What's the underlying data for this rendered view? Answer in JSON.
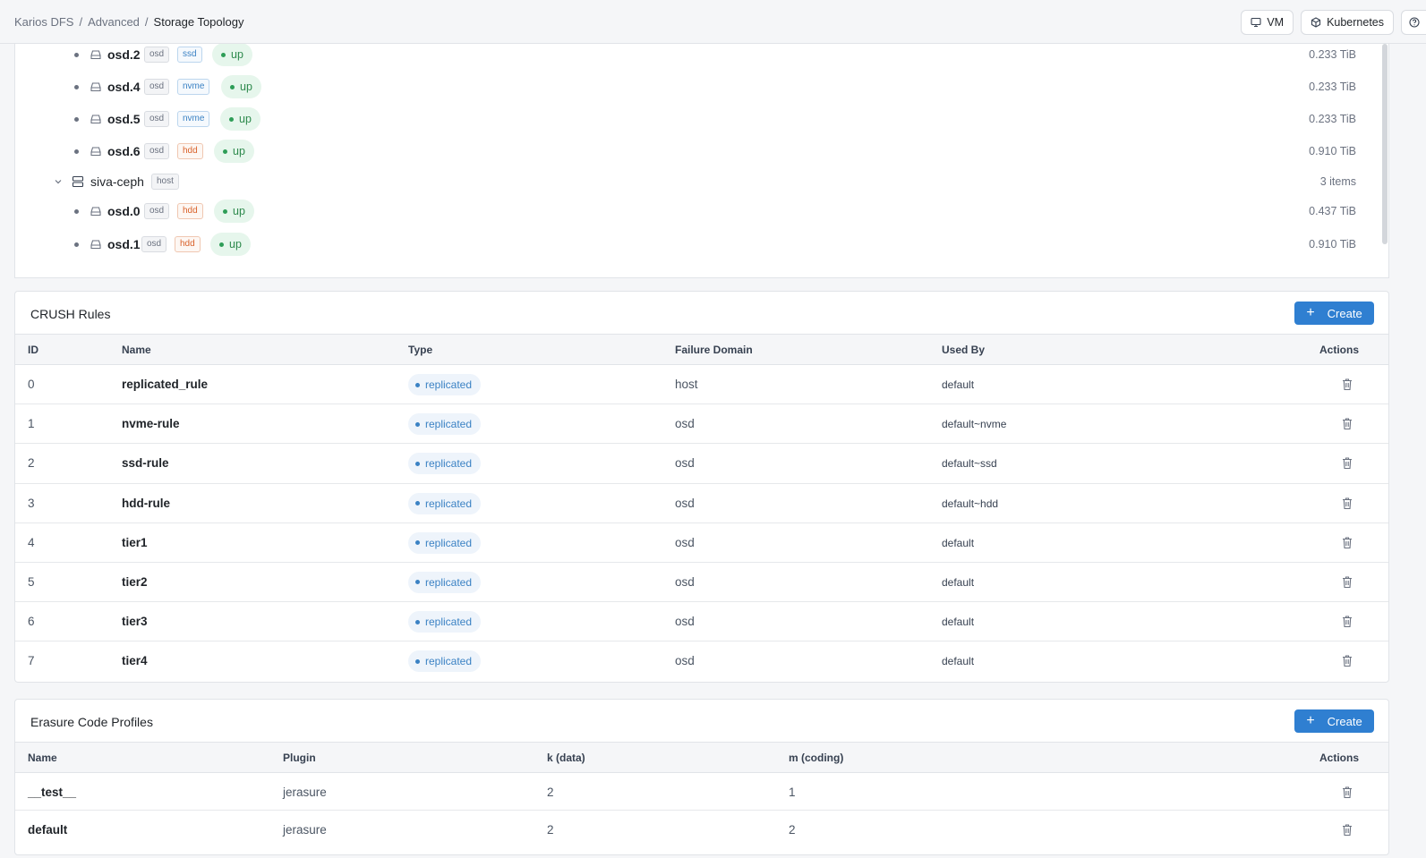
{
  "breadcrumb": {
    "root": "Karios DFS",
    "sep": "/",
    "section": "Advanced",
    "current": "Storage Topology"
  },
  "top_actions": {
    "vm": "VM",
    "kubernetes": "Kubernetes",
    "help": "?"
  },
  "topology": {
    "osd_tag": "osd",
    "host_tag": "host",
    "status_up": "up",
    "rows_a": [
      {
        "name": "osd.2",
        "class": "ssd",
        "size": "0.233 TiB"
      },
      {
        "name": "osd.4",
        "class": "nvme",
        "size": "0.233 TiB"
      },
      {
        "name": "osd.5",
        "class": "nvme",
        "size": "0.233 TiB"
      },
      {
        "name": "osd.6",
        "class": "hdd",
        "size": "0.910 TiB"
      }
    ],
    "host": {
      "name": "siva-ceph",
      "count": "3 items"
    },
    "rows_b": [
      {
        "name": "osd.0",
        "class": "hdd",
        "size": "0.437 TiB"
      },
      {
        "name": "osd.1",
        "class": "hdd",
        "size": "0.910 TiB"
      }
    ]
  },
  "crush": {
    "title": "CRUSH Rules",
    "create": "Create",
    "headers": {
      "id": "ID",
      "name": "Name",
      "type": "Type",
      "failure": "Failure Domain",
      "used_by": "Used By",
      "actions": "Actions"
    },
    "rows": [
      {
        "id": "0",
        "name": "replicated_rule",
        "type": "replicated",
        "failure": "host",
        "used_by": "default"
      },
      {
        "id": "1",
        "name": "nvme-rule",
        "type": "replicated",
        "failure": "osd",
        "used_by": "default~nvme"
      },
      {
        "id": "2",
        "name": "ssd-rule",
        "type": "replicated",
        "failure": "osd",
        "used_by": "default~ssd"
      },
      {
        "id": "3",
        "name": "hdd-rule",
        "type": "replicated",
        "failure": "osd",
        "used_by": "default~hdd"
      },
      {
        "id": "4",
        "name": "tier1",
        "type": "replicated",
        "failure": "osd",
        "used_by": "default"
      },
      {
        "id": "5",
        "name": "tier2",
        "type": "replicated",
        "failure": "osd",
        "used_by": "default"
      },
      {
        "id": "6",
        "name": "tier3",
        "type": "replicated",
        "failure": "osd",
        "used_by": "default"
      },
      {
        "id": "7",
        "name": "tier4",
        "type": "replicated",
        "failure": "osd",
        "used_by": "default"
      }
    ]
  },
  "ec": {
    "title": "Erasure Code Profiles",
    "create": "Create",
    "headers": {
      "name": "Name",
      "plugin": "Plugin",
      "k": "k (data)",
      "m": "m (coding)",
      "actions": "Actions"
    },
    "rows": [
      {
        "name": "__test__",
        "plugin": "jerasure",
        "k": "2",
        "m": "1"
      },
      {
        "name": "default",
        "plugin": "jerasure",
        "k": "2",
        "m": "2"
      }
    ]
  }
}
